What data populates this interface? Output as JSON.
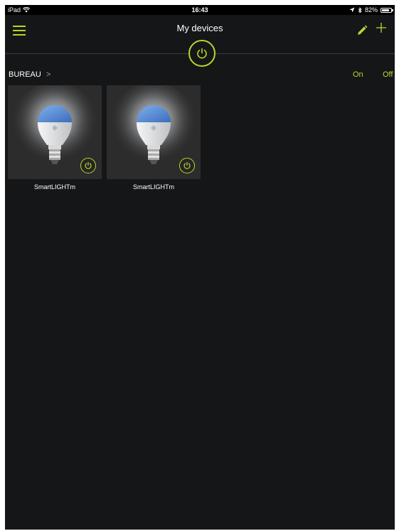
{
  "status_bar": {
    "device": "iPad",
    "time": "16:43",
    "battery_text": "82%",
    "battery_level": 0.82
  },
  "nav": {
    "title": "My devices"
  },
  "group": {
    "name": "BUREAU",
    "chevron": ">",
    "on_label": "On",
    "off_label": "Off"
  },
  "devices": [
    {
      "name": "SmartLIGHTm",
      "icon": "bulb-icon",
      "power": "power-icon"
    },
    {
      "name": "SmartLIGHTm",
      "icon": "bulb-icon",
      "power": "power-icon"
    }
  ],
  "colors": {
    "accent": "#b6d72d",
    "background": "#151617",
    "tile": "#2c2c2c",
    "bulb_blue": "#5c8fd6"
  }
}
